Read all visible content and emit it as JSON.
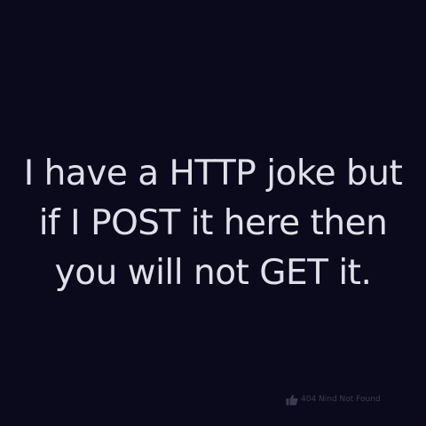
{
  "joke": {
    "lines": [
      "I have a HTTP joke but",
      "if I POST it here then",
      "you will not GET it."
    ]
  },
  "watermark": {
    "icon": "thumbs-up-icon",
    "text": "404 Nind Not Found"
  },
  "colors": {
    "background": "#0b0a1d",
    "text": "#e0e0ea",
    "watermark": "#3b3a50"
  }
}
